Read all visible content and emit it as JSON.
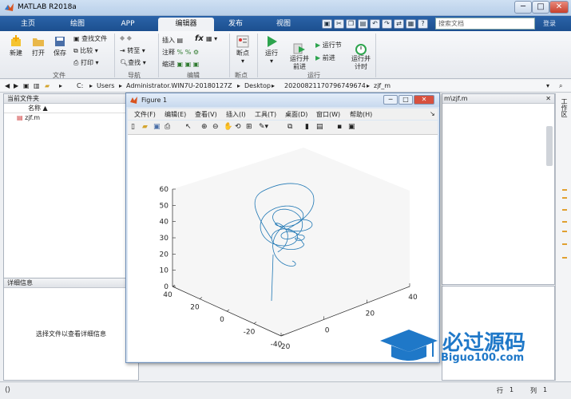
{
  "window": {
    "title": "MATLAB R2018a"
  },
  "tabs": [
    {
      "label": "主页"
    },
    {
      "label": "绘图"
    },
    {
      "label": "APP"
    },
    {
      "label": "编辑器"
    },
    {
      "label": "发布"
    },
    {
      "label": "视图"
    }
  ],
  "search": {
    "placeholder": "搜索文档"
  },
  "signin": "登录",
  "ribbon": {
    "file": {
      "new": "新建",
      "open": "打开",
      "save": "保存",
      "find_file": "查找文件",
      "compare": "比较",
      "print": "打印",
      "group": "文件"
    },
    "nav": {
      "goto": "转至",
      "find": "查找",
      "group": "导航"
    },
    "edit": {
      "insert": "插入",
      "comment": "注释",
      "indent": "缩进",
      "fx": "fx",
      "group": "编辑"
    },
    "breakpoints": {
      "label": "断点",
      "group": "断点"
    },
    "run": {
      "run": "运行",
      "run_advance": "运行并\n前进",
      "run_section": "运行节",
      "advance": "前进",
      "run_time": "运行并\n计时",
      "group": "运行"
    }
  },
  "address": {
    "segments": [
      "C:",
      "Users",
      "Administrator.WIN7U-20180127Z",
      "Desktop",
      "20200821170796749674",
      "zjf_m"
    ]
  },
  "current_folder": {
    "title": "当前文件夹",
    "col_name": "名称",
    "files": [
      "zjf.m"
    ]
  },
  "detail": {
    "title": "详细信息",
    "empty": "选择文件以查看详细信息"
  },
  "right_panel": {
    "tab_text": "m\\zjf.m",
    "side_tab": "工作区"
  },
  "status": {
    "row_label": "行",
    "row": "1",
    "col_label": "列",
    "col": "1"
  },
  "figure": {
    "title": "Figure 1",
    "menus": [
      "文件(F)",
      "编辑(E)",
      "查看(V)",
      "插入(I)",
      "工具(T)",
      "桌面(D)",
      "窗口(W)",
      "帮助(H)"
    ]
  },
  "chart_data": {
    "type": "line",
    "projection": "3d",
    "z_ticks": [
      0,
      10,
      20,
      30,
      40,
      50,
      60
    ],
    "x_ticks": [
      -20,
      0,
      20,
      40
    ],
    "y_ticks": [
      -40,
      -20,
      0,
      20,
      40
    ],
    "z_range": [
      0,
      60
    ],
    "x_range": [
      -20,
      40
    ],
    "y_range": [
      -40,
      40
    ],
    "series_color": "#1f77b4"
  },
  "watermark": {
    "brand": "必过源码",
    "url": "Biguo100.com"
  }
}
